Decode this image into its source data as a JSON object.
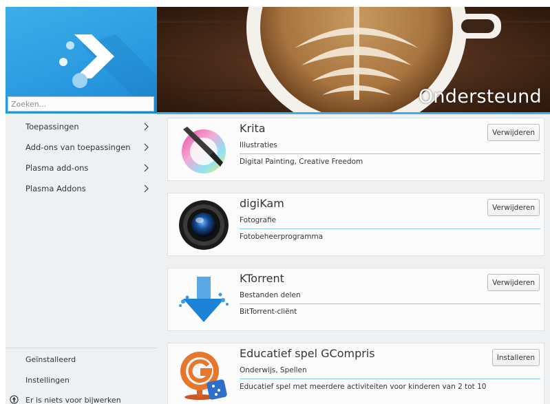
{
  "search": {
    "placeholder": "Zoeken..."
  },
  "sidebar": {
    "items": [
      {
        "label": "Toepassingen"
      },
      {
        "label": "Add-ons van toepassingen"
      },
      {
        "label": "Plasma add-ons"
      },
      {
        "label": "Plasma Addons"
      }
    ],
    "footer": {
      "installed": "Geïnstalleerd",
      "settings": "Instellingen",
      "update_status": "Er is niets voor bijwerken"
    }
  },
  "header": {
    "title": "Ondersteund"
  },
  "apps": [
    {
      "name": "Krita",
      "category": "Illustraties",
      "description": "Digital Painting, Creative Freedom",
      "action": "Verwijderen",
      "icon": "krita-icon"
    },
    {
      "name": "digiKam",
      "category": "Fotografie",
      "description": "Fotobeheerprogramma",
      "action": "Verwijderen",
      "icon": "digikam-icon"
    },
    {
      "name": "KTorrent",
      "category": "Bestanden delen",
      "description": "BitTorrent-cliënt",
      "action": "Verwijderen",
      "icon": "ktorrent-icon"
    },
    {
      "name": "Educatief spel GCompris",
      "category": "Onderwijs, Spellen",
      "description": "Educatief spel met meerdere activiteiten voor kinderen van 2 tot 10",
      "action": "Installeren",
      "icon": "gcompris-icon"
    }
  ],
  "colors": {
    "accent": "#3daee9",
    "background": "#eff0f1",
    "card": "#fcfcfc",
    "text": "#31363b"
  }
}
